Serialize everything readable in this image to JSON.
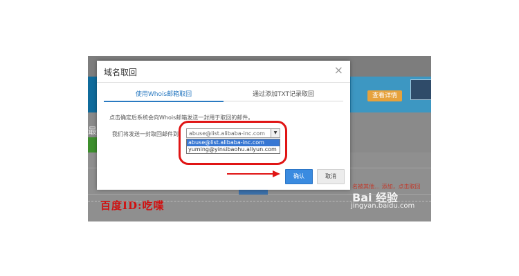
{
  "background": {
    "banner_button": "查看详情",
    "left_title": "最",
    "red_notice": "名被其他… 添加，点击取回",
    "watermark_id": "百度ID:吃喋",
    "baidu_logo": "Bai 经验",
    "baidu_url": "jingyan.baidu.com"
  },
  "dialog": {
    "title": "域名取回",
    "close_glyph": "×",
    "tabs": [
      {
        "label": "使用Whois邮箱取回",
        "active": true
      },
      {
        "label": "通过添加TXT记录取回",
        "active": false
      }
    ],
    "description": "点击确定后系统会向Whois邮箱发送一封用于取回的邮件。",
    "send_label": "我们将发送一封取回邮件到：",
    "select": {
      "value": "abuse@list.alibaba-inc.com",
      "arrow_glyph": "▼",
      "options": [
        {
          "label": "abuse@list.alibaba-inc.com",
          "selected": true
        },
        {
          "label": "yuming@yinsibaohu.aliyun.com",
          "selected": false
        }
      ]
    },
    "confirm_label": "确认",
    "cancel_label": "取消"
  },
  "colors": {
    "accent": "#2a7ac1",
    "confirm": "#3a8be0",
    "annotation_red": "#e01515"
  }
}
